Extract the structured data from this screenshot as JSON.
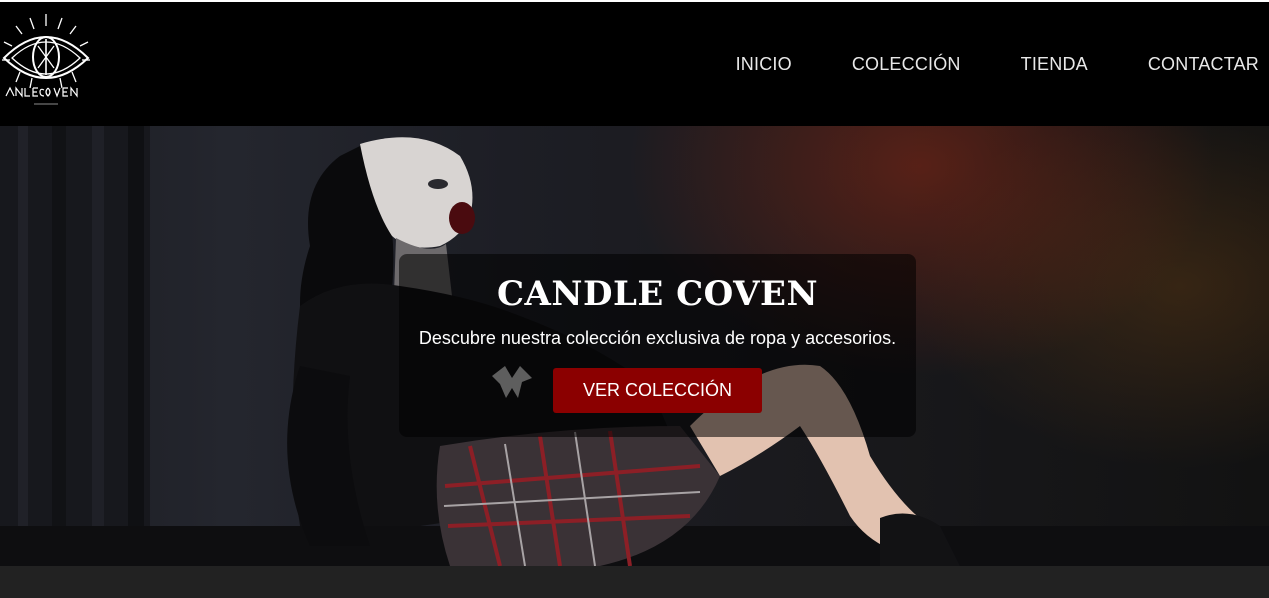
{
  "brand": {
    "logo_icon": "eye-logo-icon"
  },
  "nav": {
    "items": [
      "INICIO",
      "COLECCIÓN",
      "TIENDA",
      "CONTACTAR"
    ]
  },
  "hero": {
    "title": "CANDLE COVEN",
    "subtitle": "Descubre nuestra colección exclusiva de ropa y accesorios.",
    "cta_label": "VER COLECCIÓN"
  },
  "colors": {
    "header_bg": "#000000",
    "accent": "#8b0000",
    "footer_band": "#222222"
  }
}
